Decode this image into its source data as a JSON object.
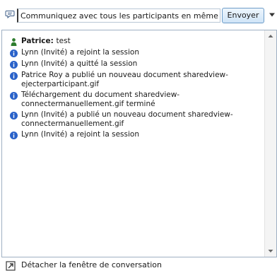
{
  "composer": {
    "input_value": "Communiquez avec tous les participants en même temps",
    "send_label": "Envoyer"
  },
  "messages": [
    {
      "icon": "person-icon",
      "sender": "Patrice",
      "separator": ": ",
      "text": "test"
    },
    {
      "icon": "info-icon",
      "text": "Lynn (Invité) a rejoint la session"
    },
    {
      "icon": "info-icon",
      "text": "Lynn (Invité) a quitté la session"
    },
    {
      "icon": "info-icon",
      "text": "Patrice Roy a publié un nouveau document sharedview-\nejecterparticipant.gif"
    },
    {
      "icon": "info-icon",
      "text": "Téléchargement du document sharedview-\nconnectermanuellement.gif terminé"
    },
    {
      "icon": "info-icon",
      "text": "Lynn (Invité) a publié un nouveau document sharedview-\nconnectermanuellement.gif"
    },
    {
      "icon": "info-icon",
      "text": "Lynn (Invité) a rejoint la session"
    }
  ],
  "footer": {
    "detach_label": "Détacher la fenêtre de conversation"
  },
  "colors": {
    "info_icon": "#2a62c9",
    "person_icon": "#2f7d2f",
    "send_border": "#6d9cc8"
  }
}
